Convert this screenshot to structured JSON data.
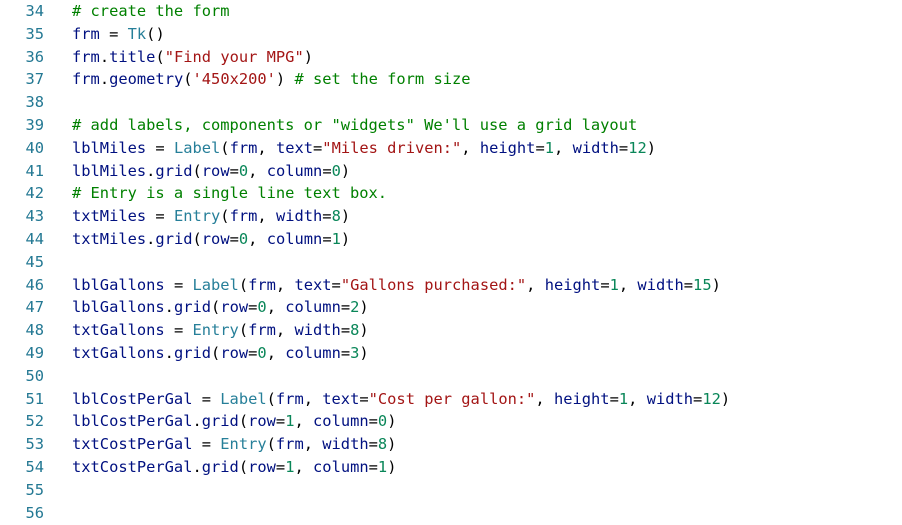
{
  "editor": {
    "lines": [
      {
        "number": "34",
        "tokens": [
          {
            "t": "# create the form",
            "k": "comment"
          }
        ]
      },
      {
        "number": "35",
        "tokens": [
          {
            "t": "frm",
            "k": "var"
          },
          {
            "t": " = ",
            "k": "op"
          },
          {
            "t": "Tk",
            "k": "class"
          },
          {
            "t": "()",
            "k": "op"
          }
        ]
      },
      {
        "number": "36",
        "tokens": [
          {
            "t": "frm",
            "k": "var"
          },
          {
            "t": ".",
            "k": "op"
          },
          {
            "t": "title",
            "k": "fn"
          },
          {
            "t": "(",
            "k": "op"
          },
          {
            "t": "\"Find your MPG\"",
            "k": "string"
          },
          {
            "t": ")",
            "k": "op"
          }
        ]
      },
      {
        "number": "37",
        "tokens": [
          {
            "t": "frm",
            "k": "var"
          },
          {
            "t": ".",
            "k": "op"
          },
          {
            "t": "geometry",
            "k": "fn"
          },
          {
            "t": "(",
            "k": "op"
          },
          {
            "t": "'450x200'",
            "k": "string"
          },
          {
            "t": ") ",
            "k": "op"
          },
          {
            "t": "# set the form size",
            "k": "comment"
          }
        ]
      },
      {
        "number": "38",
        "tokens": []
      },
      {
        "number": "39",
        "tokens": [
          {
            "t": "# add labels, components or \"widgets\" We'll use a grid layout",
            "k": "comment"
          }
        ]
      },
      {
        "number": "40",
        "tokens": [
          {
            "t": "lblMiles",
            "k": "var"
          },
          {
            "t": " = ",
            "k": "op"
          },
          {
            "t": "Label",
            "k": "class"
          },
          {
            "t": "(",
            "k": "op"
          },
          {
            "t": "frm",
            "k": "var"
          },
          {
            "t": ", ",
            "k": "op"
          },
          {
            "t": "text",
            "k": "var"
          },
          {
            "t": "=",
            "k": "op"
          },
          {
            "t": "\"Miles driven:\"",
            "k": "string"
          },
          {
            "t": ", ",
            "k": "op"
          },
          {
            "t": "height",
            "k": "var"
          },
          {
            "t": "=",
            "k": "op"
          },
          {
            "t": "1",
            "k": "number"
          },
          {
            "t": ", ",
            "k": "op"
          },
          {
            "t": "width",
            "k": "var"
          },
          {
            "t": "=",
            "k": "op"
          },
          {
            "t": "12",
            "k": "number"
          },
          {
            "t": ")",
            "k": "op"
          }
        ]
      },
      {
        "number": "41",
        "tokens": [
          {
            "t": "lblMiles",
            "k": "var"
          },
          {
            "t": ".",
            "k": "op"
          },
          {
            "t": "grid",
            "k": "fn"
          },
          {
            "t": "(",
            "k": "op"
          },
          {
            "t": "row",
            "k": "var"
          },
          {
            "t": "=",
            "k": "op"
          },
          {
            "t": "0",
            "k": "number"
          },
          {
            "t": ", ",
            "k": "op"
          },
          {
            "t": "column",
            "k": "var"
          },
          {
            "t": "=",
            "k": "op"
          },
          {
            "t": "0",
            "k": "number"
          },
          {
            "t": ")",
            "k": "op"
          }
        ]
      },
      {
        "number": "42",
        "tokens": [
          {
            "t": "# Entry is a single line text box.",
            "k": "comment"
          }
        ]
      },
      {
        "number": "43",
        "tokens": [
          {
            "t": "txtMiles",
            "k": "var"
          },
          {
            "t": " = ",
            "k": "op"
          },
          {
            "t": "Entry",
            "k": "class"
          },
          {
            "t": "(",
            "k": "op"
          },
          {
            "t": "frm",
            "k": "var"
          },
          {
            "t": ", ",
            "k": "op"
          },
          {
            "t": "width",
            "k": "var"
          },
          {
            "t": "=",
            "k": "op"
          },
          {
            "t": "8",
            "k": "number"
          },
          {
            "t": ")",
            "k": "op"
          }
        ]
      },
      {
        "number": "44",
        "tokens": [
          {
            "t": "txtMiles",
            "k": "var"
          },
          {
            "t": ".",
            "k": "op"
          },
          {
            "t": "grid",
            "k": "fn"
          },
          {
            "t": "(",
            "k": "op"
          },
          {
            "t": "row",
            "k": "var"
          },
          {
            "t": "=",
            "k": "op"
          },
          {
            "t": "0",
            "k": "number"
          },
          {
            "t": ", ",
            "k": "op"
          },
          {
            "t": "column",
            "k": "var"
          },
          {
            "t": "=",
            "k": "op"
          },
          {
            "t": "1",
            "k": "number"
          },
          {
            "t": ")",
            "k": "op"
          }
        ]
      },
      {
        "number": "45",
        "tokens": []
      },
      {
        "number": "46",
        "tokens": [
          {
            "t": "lblGallons",
            "k": "var"
          },
          {
            "t": " = ",
            "k": "op"
          },
          {
            "t": "Label",
            "k": "class"
          },
          {
            "t": "(",
            "k": "op"
          },
          {
            "t": "frm",
            "k": "var"
          },
          {
            "t": ", ",
            "k": "op"
          },
          {
            "t": "text",
            "k": "var"
          },
          {
            "t": "=",
            "k": "op"
          },
          {
            "t": "\"Gallons purchased:\"",
            "k": "string"
          },
          {
            "t": ", ",
            "k": "op"
          },
          {
            "t": "height",
            "k": "var"
          },
          {
            "t": "=",
            "k": "op"
          },
          {
            "t": "1",
            "k": "number"
          },
          {
            "t": ", ",
            "k": "op"
          },
          {
            "t": "width",
            "k": "var"
          },
          {
            "t": "=",
            "k": "op"
          },
          {
            "t": "15",
            "k": "number"
          },
          {
            "t": ")",
            "k": "op"
          }
        ]
      },
      {
        "number": "47",
        "tokens": [
          {
            "t": "lblGallons",
            "k": "var"
          },
          {
            "t": ".",
            "k": "op"
          },
          {
            "t": "grid",
            "k": "fn"
          },
          {
            "t": "(",
            "k": "op"
          },
          {
            "t": "row",
            "k": "var"
          },
          {
            "t": "=",
            "k": "op"
          },
          {
            "t": "0",
            "k": "number"
          },
          {
            "t": ", ",
            "k": "op"
          },
          {
            "t": "column",
            "k": "var"
          },
          {
            "t": "=",
            "k": "op"
          },
          {
            "t": "2",
            "k": "number"
          },
          {
            "t": ")",
            "k": "op"
          }
        ]
      },
      {
        "number": "48",
        "tokens": [
          {
            "t": "txtGallons",
            "k": "var"
          },
          {
            "t": " = ",
            "k": "op"
          },
          {
            "t": "Entry",
            "k": "class"
          },
          {
            "t": "(",
            "k": "op"
          },
          {
            "t": "frm",
            "k": "var"
          },
          {
            "t": ", ",
            "k": "op"
          },
          {
            "t": "width",
            "k": "var"
          },
          {
            "t": "=",
            "k": "op"
          },
          {
            "t": "8",
            "k": "number"
          },
          {
            "t": ")",
            "k": "op"
          }
        ]
      },
      {
        "number": "49",
        "tokens": [
          {
            "t": "txtGallons",
            "k": "var"
          },
          {
            "t": ".",
            "k": "op"
          },
          {
            "t": "grid",
            "k": "fn"
          },
          {
            "t": "(",
            "k": "op"
          },
          {
            "t": "row",
            "k": "var"
          },
          {
            "t": "=",
            "k": "op"
          },
          {
            "t": "0",
            "k": "number"
          },
          {
            "t": ", ",
            "k": "op"
          },
          {
            "t": "column",
            "k": "var"
          },
          {
            "t": "=",
            "k": "op"
          },
          {
            "t": "3",
            "k": "number"
          },
          {
            "t": ")",
            "k": "op"
          }
        ]
      },
      {
        "number": "50",
        "tokens": []
      },
      {
        "number": "51",
        "tokens": [
          {
            "t": "lblCostPerGal",
            "k": "var"
          },
          {
            "t": " = ",
            "k": "op"
          },
          {
            "t": "Label",
            "k": "class"
          },
          {
            "t": "(",
            "k": "op"
          },
          {
            "t": "frm",
            "k": "var"
          },
          {
            "t": ", ",
            "k": "op"
          },
          {
            "t": "text",
            "k": "var"
          },
          {
            "t": "=",
            "k": "op"
          },
          {
            "t": "\"Cost per gallon:\"",
            "k": "string"
          },
          {
            "t": ", ",
            "k": "op"
          },
          {
            "t": "height",
            "k": "var"
          },
          {
            "t": "=",
            "k": "op"
          },
          {
            "t": "1",
            "k": "number"
          },
          {
            "t": ", ",
            "k": "op"
          },
          {
            "t": "width",
            "k": "var"
          },
          {
            "t": "=",
            "k": "op"
          },
          {
            "t": "12",
            "k": "number"
          },
          {
            "t": ")",
            "k": "op"
          }
        ]
      },
      {
        "number": "52",
        "tokens": [
          {
            "t": "lblCostPerGal",
            "k": "var"
          },
          {
            "t": ".",
            "k": "op"
          },
          {
            "t": "grid",
            "k": "fn"
          },
          {
            "t": "(",
            "k": "op"
          },
          {
            "t": "row",
            "k": "var"
          },
          {
            "t": "=",
            "k": "op"
          },
          {
            "t": "1",
            "k": "number"
          },
          {
            "t": ", ",
            "k": "op"
          },
          {
            "t": "column",
            "k": "var"
          },
          {
            "t": "=",
            "k": "op"
          },
          {
            "t": "0",
            "k": "number"
          },
          {
            "t": ")",
            "k": "op"
          }
        ]
      },
      {
        "number": "53",
        "tokens": [
          {
            "t": "txtCostPerGal",
            "k": "var"
          },
          {
            "t": " = ",
            "k": "op"
          },
          {
            "t": "Entry",
            "k": "class"
          },
          {
            "t": "(",
            "k": "op"
          },
          {
            "t": "frm",
            "k": "var"
          },
          {
            "t": ", ",
            "k": "op"
          },
          {
            "t": "width",
            "k": "var"
          },
          {
            "t": "=",
            "k": "op"
          },
          {
            "t": "8",
            "k": "number"
          },
          {
            "t": ")",
            "k": "op"
          }
        ]
      },
      {
        "number": "54",
        "tokens": [
          {
            "t": "txtCostPerGal",
            "k": "var"
          },
          {
            "t": ".",
            "k": "op"
          },
          {
            "t": "grid",
            "k": "fn"
          },
          {
            "t": "(",
            "k": "op"
          },
          {
            "t": "row",
            "k": "var"
          },
          {
            "t": "=",
            "k": "op"
          },
          {
            "t": "1",
            "k": "number"
          },
          {
            "t": ", ",
            "k": "op"
          },
          {
            "t": "column",
            "k": "var"
          },
          {
            "t": "=",
            "k": "op"
          },
          {
            "t": "1",
            "k": "number"
          },
          {
            "t": ")",
            "k": "op"
          }
        ]
      },
      {
        "number": "55",
        "tokens": []
      },
      {
        "number": "56",
        "tokens": []
      }
    ]
  },
  "colors": {
    "background": "#ffffff",
    "line_number": "#237893",
    "comment": "#008000",
    "string": "#a31515",
    "number": "#098658",
    "class": "#267f99",
    "variable": "#001080",
    "operator": "#000000"
  }
}
